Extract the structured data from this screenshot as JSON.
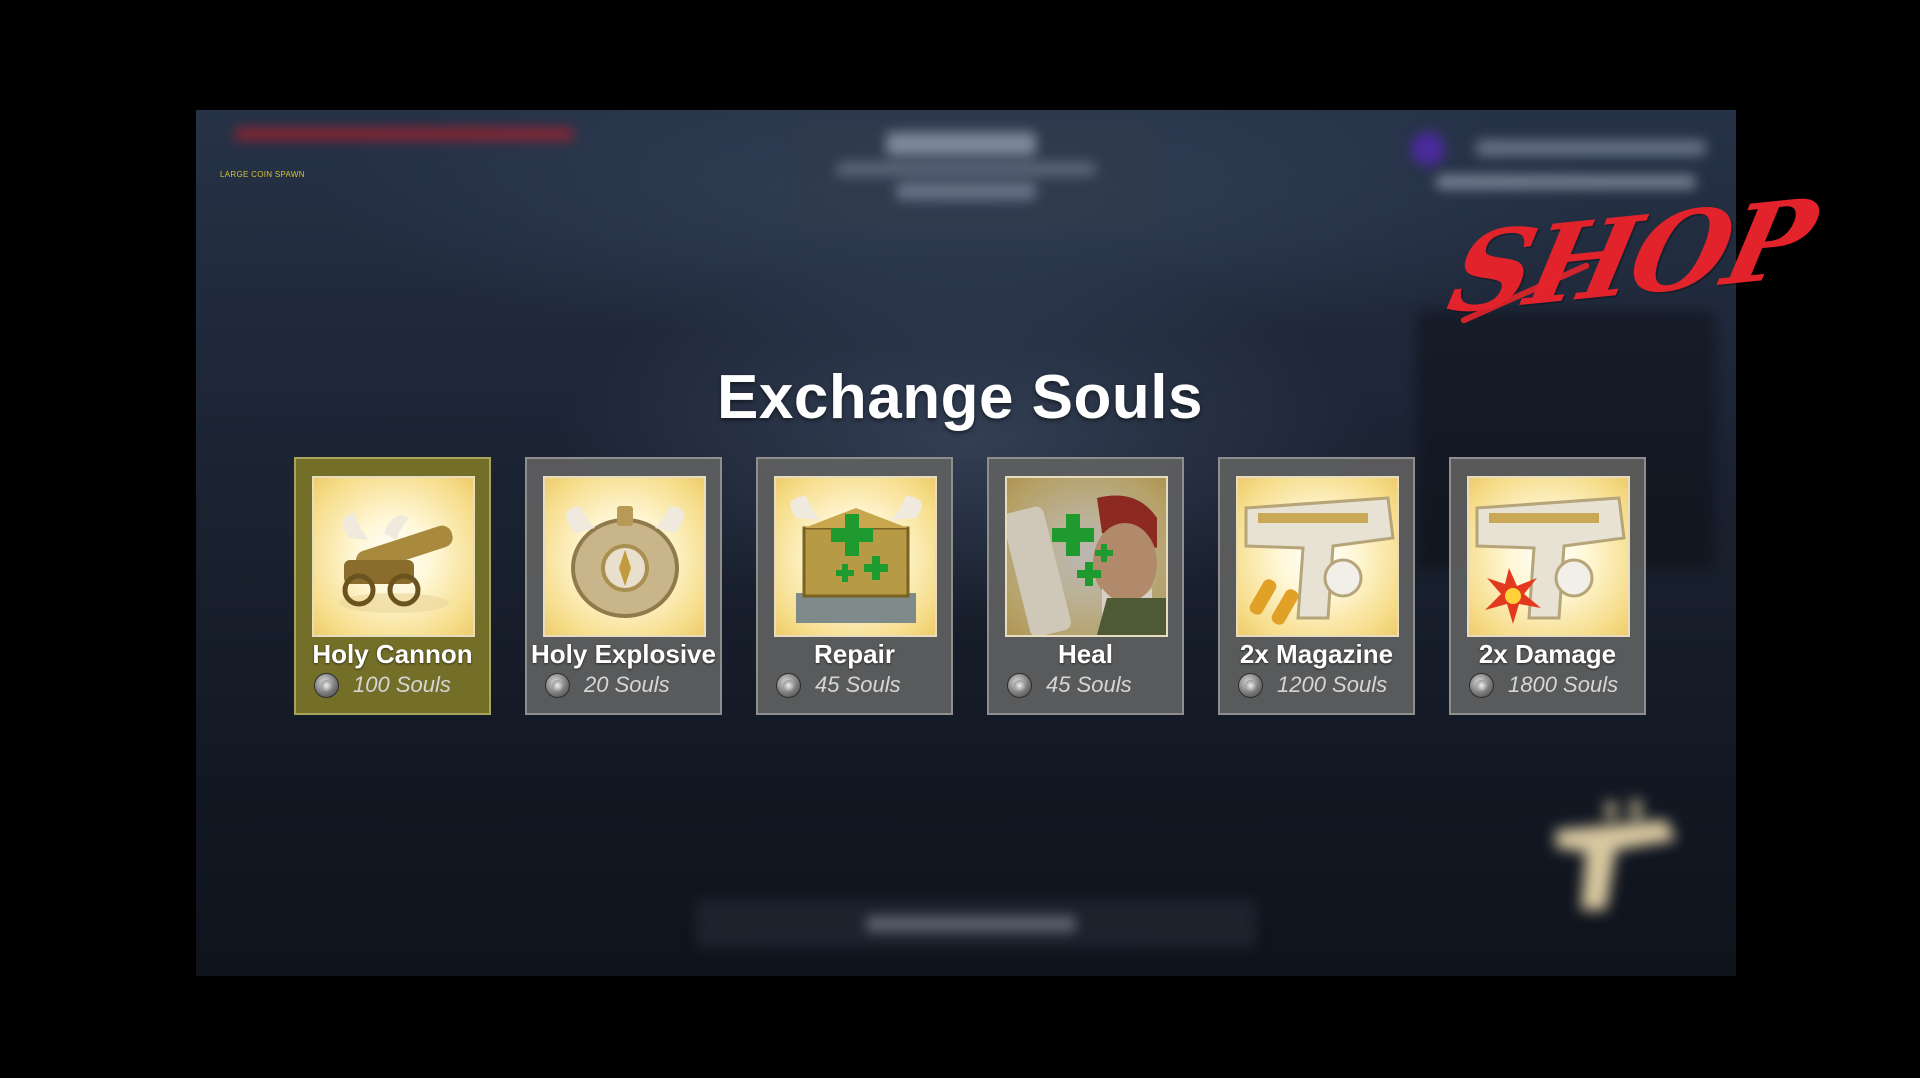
{
  "hud": {
    "hint_text": "LARGE COIN SPAWN"
  },
  "logo": {
    "text": "SHOP",
    "color": "#e3232b"
  },
  "shop": {
    "title": "Exchange Souls",
    "currency_icon": "soul-coin-icon",
    "items": [
      {
        "name": "Holy Cannon",
        "price": "100 Souls",
        "icon": "cannon-icon",
        "selected": true
      },
      {
        "name": "Holy Explosive",
        "price": "20 Souls",
        "icon": "explosive-barrel-icon",
        "selected": false
      },
      {
        "name": "Repair",
        "price": "45 Souls",
        "icon": "repair-ark-icon",
        "selected": false
      },
      {
        "name": "Heal",
        "price": "45 Souls",
        "icon": "heal-soldier-icon",
        "selected": false
      },
      {
        "name": "2x Magazine",
        "price": "1200 Souls",
        "icon": "magazine-pistol-icon",
        "selected": false
      },
      {
        "name": "2x Damage",
        "price": "1800 Souls",
        "icon": "damage-pistol-icon",
        "selected": false
      }
    ]
  },
  "colors": {
    "selected_card": "#78732a",
    "card": "#5f5f5f",
    "heal_cross": "#1f9a2e"
  }
}
